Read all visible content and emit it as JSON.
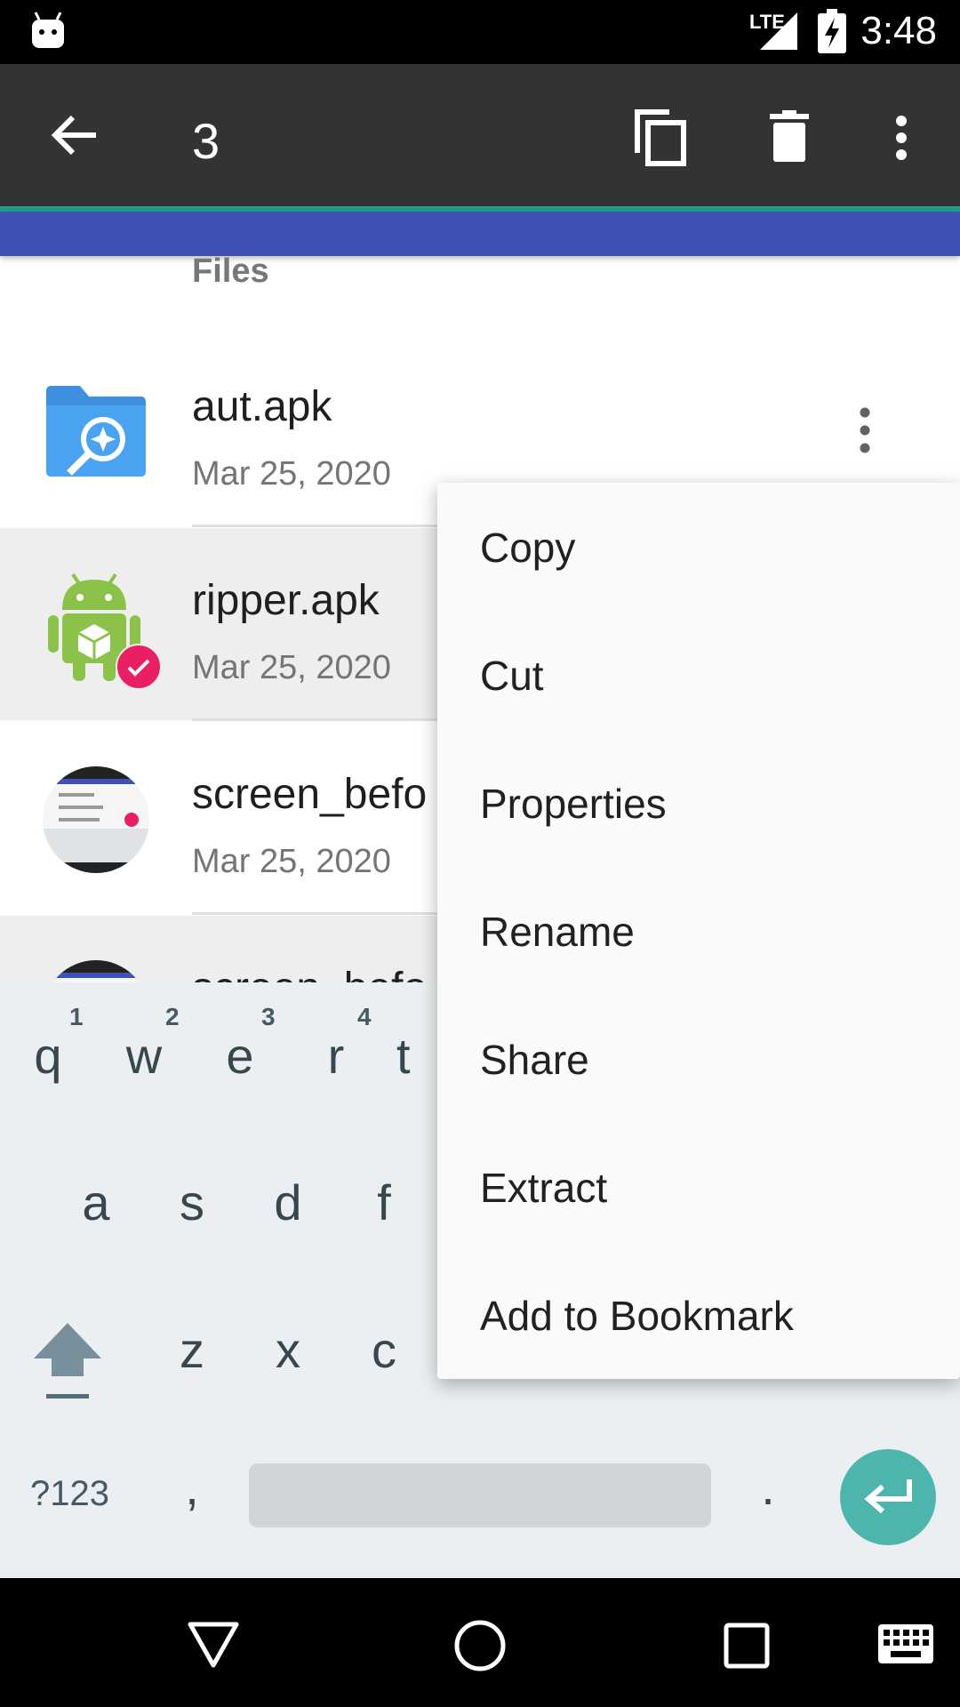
{
  "status_bar": {
    "network": "LTE",
    "time": "3:48"
  },
  "action_bar": {
    "selected_count": "3"
  },
  "list": {
    "section_header": "Files",
    "items": [
      {
        "name": "aut.apk",
        "date": "Mar 25, 2020",
        "selected": false
      },
      {
        "name": "ripper.apk",
        "date": "Mar 25, 2020",
        "selected": true
      },
      {
        "name": "screen_befo",
        "date": "Mar 25, 2020",
        "selected": false
      },
      {
        "name": "screen_befo",
        "date": "",
        "selected": true
      }
    ]
  },
  "keyboard": {
    "row1": [
      "q",
      "w",
      "e",
      "r",
      "t"
    ],
    "row1_hints": [
      "1",
      "2",
      "3",
      "4"
    ],
    "row2": [
      "a",
      "s",
      "d",
      "f"
    ],
    "row3": [
      "z",
      "x",
      "c"
    ],
    "symbols_label": "?123",
    "comma": ",",
    "period": "."
  },
  "menu": {
    "items": [
      "Copy",
      "Cut",
      "Properties",
      "Rename",
      "Share",
      "Extract",
      "Add to Bookmark"
    ]
  },
  "colors": {
    "action_bar": "#333333",
    "accent_line": "#1e9f86",
    "primary": "#3f51b5",
    "selection_badge": "#e91e63",
    "enter_key": "#4db6ac"
  },
  "icons": [
    "android-robot-icon",
    "back-arrow-icon",
    "copy-icon",
    "delete-icon",
    "more-vert-icon",
    "folder-search-icon",
    "android-apk-icon",
    "check-badge-icon",
    "thumbnail-icon",
    "shift-icon",
    "enter-icon",
    "back-nav-icon",
    "home-nav-icon",
    "recents-nav-icon",
    "keyboard-switch-icon"
  ]
}
